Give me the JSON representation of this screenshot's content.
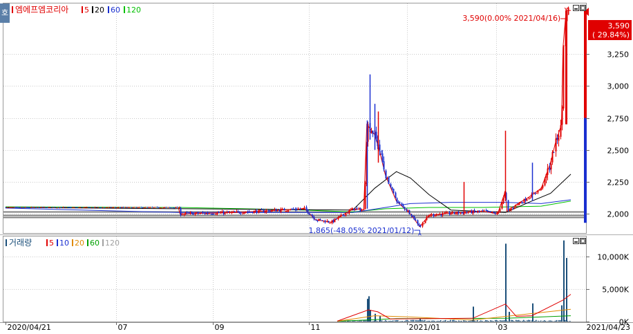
{
  "colors": {
    "up": "#e00000",
    "down": "#1a2fd0",
    "ma5": "#e00000",
    "ma20": "#000000",
    "ma60": "#1a2fd0",
    "ma120": "#00c000",
    "vol_bar": "#1b4f7a",
    "vma5": "#e00000",
    "vma10": "#1a2fd0",
    "vma20": "#e08a00",
    "vma60": "#00a000",
    "vma120": "#a0a0a0",
    "grid": "#c8c8c8",
    "ref_line": "#808080",
    "price_box": "#e00000"
  },
  "header": {
    "toggle_label": "호",
    "stock_name": "엠에프엠코리아",
    "ma_labels": [
      "5",
      "20",
      "60",
      "120"
    ],
    "volume_title": "거래량",
    "vma_labels": [
      "5",
      "10",
      "20",
      "60",
      "120"
    ]
  },
  "chart_data": [
    {
      "type": "candlestick",
      "name": "price",
      "ylim": [
        1850,
        3650
      ],
      "yticks": [
        2000,
        2250,
        2500,
        2750,
        3000,
        3250
      ],
      "ytick_labels": [
        "2,000",
        "2,250",
        "2,500",
        "2,750",
        "3,000",
        "3,250"
      ],
      "price_box": {
        "value": "3,590",
        "change": "( 29.84%)"
      },
      "annotations": {
        "high": {
          "text": "3,590(0.00% 2021/04/16)",
          "x": "2021/04/16",
          "y": 3590
        },
        "low": {
          "text": "1,865(-48.05% 2021/01/12)",
          "x": "2021/01/12",
          "y": 1865
        }
      },
      "reference_levels": [
        2015,
        1990,
        1975
      ],
      "keypoints": [
        {
          "x": "2020/04/21",
          "y": 2050
        },
        {
          "x": "2020/08/10",
          "y": 2050
        },
        {
          "x": "2020/08/11",
          "y": 2000
        },
        {
          "x": "2020/09/15",
          "y": 2010
        },
        {
          "x": "2020/10/30",
          "y": 2040
        },
        {
          "x": "2020/11/06",
          "y": 1955
        },
        {
          "x": "2020/11/16",
          "y": 1935
        },
        {
          "x": "2020/11/30",
          "y": 2040
        },
        {
          "x": "2020/12/07",
          "y": 2030
        },
        {
          "x": "2020/12/09",
          "y": 2700
        },
        {
          "x": "2020/12/14",
          "y": 2620
        },
        {
          "x": "2020/12/17",
          "y": 2500
        },
        {
          "x": "2020/12/21",
          "y": 2300
        },
        {
          "x": "2020/12/28",
          "y": 2100
        },
        {
          "x": "2021/01/06",
          "y": 2000
        },
        {
          "x": "2021/01/12",
          "y": 1900
        },
        {
          "x": "2021/01/18",
          "y": 1990
        },
        {
          "x": "2021/02/01",
          "y": 2005
        },
        {
          "x": "2021/02/22",
          "y": 2020
        },
        {
          "x": "2021/03/03",
          "y": 2000
        },
        {
          "x": "2021/03/08",
          "y": 2180
        },
        {
          "x": "2021/03/09",
          "y": 2020
        },
        {
          "x": "2021/03/16",
          "y": 2080
        },
        {
          "x": "2021/03/23",
          "y": 2130
        },
        {
          "x": "2021/03/31",
          "y": 2200
        },
        {
          "x": "2021/04/06",
          "y": 2400
        },
        {
          "x": "2021/04/09",
          "y": 2550
        },
        {
          "x": "2021/04/13",
          "y": 2700
        },
        {
          "x": "2021/04/14",
          "y": 3300
        },
        {
          "x": "2021/04/16",
          "y": 3590
        },
        {
          "x": "2021/04/19",
          "y": 3590
        }
      ],
      "spikes": [
        {
          "x": "2020/12/09",
          "high": 2730,
          "low": 2040
        },
        {
          "x": "2020/12/11",
          "high": 3090,
          "low": 2580
        },
        {
          "x": "2020/12/14",
          "high": 2860,
          "low": 2500
        },
        {
          "x": "2020/12/16",
          "high": 2800,
          "low": 2400
        },
        {
          "x": "2021/02/09",
          "high": 2250,
          "low": 1990
        },
        {
          "x": "2021/03/08",
          "high": 2650,
          "low": 2100
        },
        {
          "x": "2021/03/25",
          "high": 2400,
          "low": 2100
        }
      ],
      "ma_curves": {
        "ma20": [
          {
            "x": "2020/04/21",
            "y": 2050
          },
          {
            "x": "2020/11/30",
            "y": 2030
          },
          {
            "x": "2020/12/14",
            "y": 2200
          },
          {
            "x": "2020/12/28",
            "y": 2330
          },
          {
            "x": "2021/01/06",
            "y": 2280
          },
          {
            "x": "2021/01/18",
            "y": 2150
          },
          {
            "x": "2021/02/01",
            "y": 2030
          },
          {
            "x": "2021/03/08",
            "y": 2010
          },
          {
            "x": "2021/03/23",
            "y": 2090
          },
          {
            "x": "2021/04/06",
            "y": 2160
          },
          {
            "x": "2021/04/19",
            "y": 2310
          }
        ],
        "ma60": [
          {
            "x": "2020/04/21",
            "y": 2045
          },
          {
            "x": "2020/08/11",
            "y": 2010
          },
          {
            "x": "2020/11/30",
            "y": 2010
          },
          {
            "x": "2020/12/21",
            "y": 2050
          },
          {
            "x": "2021/01/06",
            "y": 2080
          },
          {
            "x": "2021/02/01",
            "y": 2090
          },
          {
            "x": "2021/03/08",
            "y": 2090
          },
          {
            "x": "2021/03/31",
            "y": 2080
          },
          {
            "x": "2021/04/19",
            "y": 2110
          }
        ],
        "ma120": [
          {
            "x": "2020/04/21",
            "y": 2055
          },
          {
            "x": "2020/08/11",
            "y": 2050
          },
          {
            "x": "2020/10/30",
            "y": 2030
          },
          {
            "x": "2020/11/30",
            "y": 2015
          },
          {
            "x": "2020/12/21",
            "y": 2040
          },
          {
            "x": "2021/01/18",
            "y": 2050
          },
          {
            "x": "2021/02/22",
            "y": 2050
          },
          {
            "x": "2021/03/31",
            "y": 2060
          },
          {
            "x": "2021/04/19",
            "y": 2100
          }
        ]
      }
    },
    {
      "type": "bar",
      "name": "volume",
      "ylim": [
        0,
        13000
      ],
      "yticks": [
        0,
        5000,
        10000
      ],
      "ytick_labels": [
        "0K",
        "5,000K",
        "10,000K"
      ],
      "bars": [
        {
          "x": "2020/11/26",
          "y": 120
        },
        {
          "x": "2020/12/09",
          "y": 3500
        },
        {
          "x": "2020/12/10",
          "y": 3900
        },
        {
          "x": "2020/12/11",
          "y": 1800
        },
        {
          "x": "2020/12/14",
          "y": 1200
        },
        {
          "x": "2020/12/17",
          "y": 900
        },
        {
          "x": "2021/01/12",
          "y": 500
        },
        {
          "x": "2021/02/15",
          "y": 2300
        },
        {
          "x": "2021/03/08",
          "y": 12000
        },
        {
          "x": "2021/03/10",
          "y": 1500
        },
        {
          "x": "2021/03/25",
          "y": 2800
        },
        {
          "x": "2021/04/13",
          "y": 2500
        },
        {
          "x": "2021/04/14",
          "y": 12500
        },
        {
          "x": "2021/04/16",
          "y": 9800
        }
      ],
      "vma5": [
        {
          "x": "2020/11/20",
          "y": 60
        },
        {
          "x": "2020/12/10",
          "y": 1800
        },
        {
          "x": "2020/12/16",
          "y": 1500
        },
        {
          "x": "2020/12/24",
          "y": 400
        },
        {
          "x": "2021/02/15",
          "y": 500
        },
        {
          "x": "2021/03/08",
          "y": 2700
        },
        {
          "x": "2021/03/15",
          "y": 800
        },
        {
          "x": "2021/03/25",
          "y": 900
        },
        {
          "x": "2021/04/14",
          "y": 3300
        },
        {
          "x": "2021/04/19",
          "y": 4200
        }
      ],
      "vma20": [
        {
          "x": "2020/11/20",
          "y": 50
        },
        {
          "x": "2020/12/14",
          "y": 900
        },
        {
          "x": "2021/01/06",
          "y": 700
        },
        {
          "x": "2021/02/15",
          "y": 250
        },
        {
          "x": "2021/03/16",
          "y": 1000
        },
        {
          "x": "2021/04/19",
          "y": 1900
        }
      ],
      "vma60": [
        {
          "x": "2020/11/20",
          "y": 40
        },
        {
          "x": "2020/12/28",
          "y": 450
        },
        {
          "x": "2021/03/08",
          "y": 500
        },
        {
          "x": "2021/04/19",
          "y": 900
        }
      ]
    }
  ],
  "x_axis": {
    "start": "2020/04/21",
    "end": "2021/04/19",
    "ticks": [
      {
        "x": "2020/04/21",
        "label": "2020/04/21"
      },
      {
        "x": "2020/07/01",
        "label": "07"
      },
      {
        "x": "2020/09/01",
        "label": "09"
      },
      {
        "x": "2020/11/02",
        "label": "11"
      },
      {
        "x": "2021/01/04",
        "label": "2021/01"
      },
      {
        "x": "2021/03/02",
        "label": "03"
      }
    ],
    "end_label": "2021/04/23"
  }
}
